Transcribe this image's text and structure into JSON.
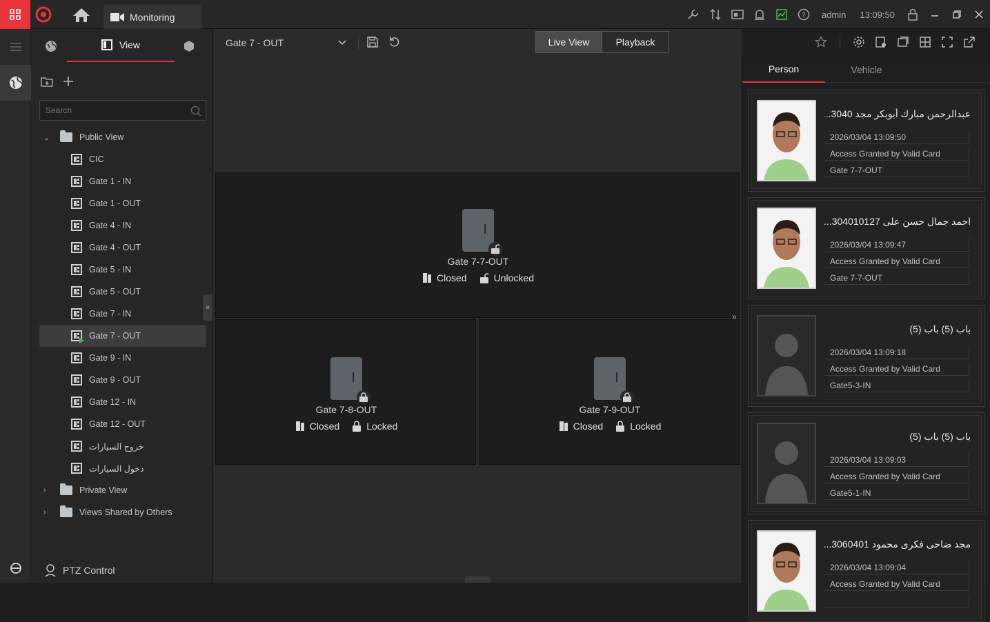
{
  "titlebar": {
    "tab_label": "Monitoring",
    "user": "admin",
    "time": "13:09:50",
    "icons": [
      "tools-icon",
      "transfer-icon",
      "card-reader-icon",
      "alarm-icon",
      "performance-icon",
      "help-icon"
    ]
  },
  "left_panel": {
    "tab_label": "View",
    "search_placeholder": "Search",
    "public_view": "Public View",
    "views": [
      "CIC",
      "Gate 1 - IN",
      "Gate 1 - OUT",
      "Gate 4 - IN",
      "Gate 4 - OUT",
      "Gate 5 - IN",
      "Gate 5 - OUT",
      "Gate 7 - IN",
      "Gate 7 - OUT",
      "Gate 9 - IN",
      "Gate 9 - OUT",
      "Gate 12 - IN",
      "Gate 12 - OUT",
      "خروج السيارات",
      "دخول السيارات"
    ],
    "selected_view": "Gate 7 - OUT",
    "private_view": "Private View",
    "shared_view": "Views Shared by Others",
    "ptz_label": "PTZ Control"
  },
  "toolbar": {
    "device_select": "Gate 7 - OUT",
    "live_view": "Live View",
    "playback": "Playback"
  },
  "doors": [
    {
      "name": "Gate 7-7-OUT",
      "door_status": "Closed",
      "lock_status": "Unlocked"
    },
    {
      "name": "Gate 7-8-OUT",
      "door_status": "Closed",
      "lock_status": "Locked"
    },
    {
      "name": "Gate 7-9-OUT",
      "door_status": "Closed",
      "lock_status": "Locked"
    }
  ],
  "right_panel": {
    "tab_person": "Person",
    "tab_vehicle": "Vehicle",
    "events": [
      {
        "name": "عبدالرحمن مبارك أبوبكر مجد 3040...",
        "time": "2026/03/04 13:09:50",
        "result": "Access Granted by Valid Card",
        "door": "Gate 7-7-OUT",
        "photo": "face"
      },
      {
        "name": "احمد جمال حسن على 304010127...",
        "time": "2026/03/04 13:09:47",
        "result": "Access Granted by Valid Card",
        "door": "Gate 7-7-OUT",
        "photo": "face"
      },
      {
        "name": "باب (5) باب (5)",
        "time": "2026/03/04 13:09:18",
        "result": "Access Granted by Valid Card",
        "door": "Gate5-3-IN",
        "photo": "placeholder"
      },
      {
        "name": "باب (5) باب (5)",
        "time": "2026/03/04 13:09:03",
        "result": "Access Granted by Valid Card",
        "door": "Gate5-1-IN",
        "photo": "placeholder"
      },
      {
        "name": "مجد ضاحى فكرى محمود 3060401...",
        "time": "2026/03/04 13:09:04",
        "result": "Access Granted by Valid Card",
        "door": "",
        "photo": "face"
      }
    ]
  },
  "colors": {
    "accent": "#e8343a",
    "online": "#3bc04a"
  }
}
